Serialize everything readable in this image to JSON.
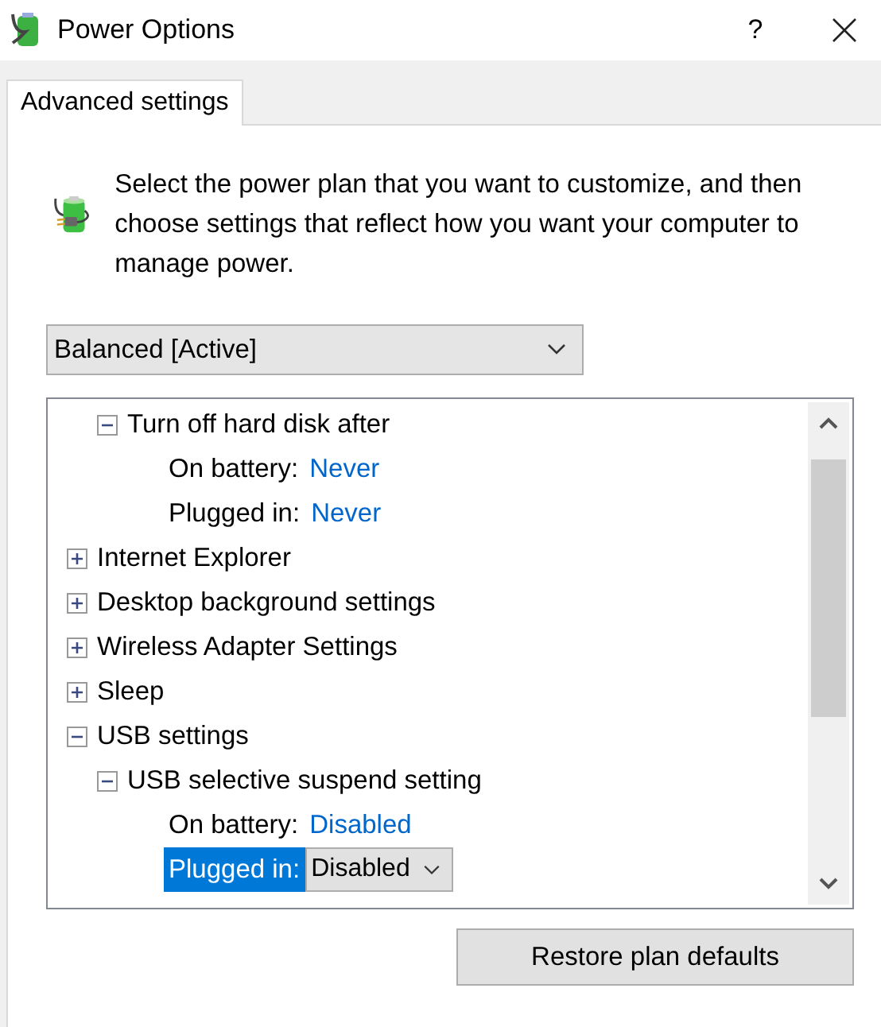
{
  "window": {
    "title": "Power Options",
    "help": "?"
  },
  "tabs": [
    {
      "label": "Advanced settings",
      "selected": true
    }
  ],
  "intro": "Select the power plan that you want to customize, and then choose settings that reflect how you want your computer to manage power.",
  "plan": {
    "value": "Balanced [Active]"
  },
  "tree": [
    {
      "children": [
        {
          "label": "Turn off hard disk after",
          "kind": "group",
          "expanded": true,
          "children": [
            {
              "kind": "value",
              "label": "On battery:",
              "value": "Never",
              "selected": false
            },
            {
              "kind": "value",
              "label": "Plugged in:",
              "value": "Never",
              "selected": false
            }
          ]
        }
      ]
    },
    {
      "kind": "group",
      "label": "Internet Explorer",
      "expanded": false
    },
    {
      "kind": "group",
      "label": "Desktop background settings",
      "expanded": false
    },
    {
      "kind": "group",
      "label": "Wireless Adapter Settings",
      "expanded": false
    },
    {
      "kind": "group",
      "label": "Sleep",
      "expanded": false
    },
    {
      "kind": "group",
      "label": "USB settings",
      "expanded": true,
      "children": [
        {
          "kind": "group",
          "label": "USB selective suspend setting",
          "expanded": true,
          "children": [
            {
              "kind": "value",
              "label": "On battery:",
              "value": "Disabled",
              "selected": false
            },
            {
              "kind": "value",
              "label": "Plugged in:",
              "value": "Disabled",
              "selected": true
            }
          ]
        }
      ]
    }
  ],
  "buttons": [
    {
      "label": "Restore plan defaults"
    }
  ]
}
